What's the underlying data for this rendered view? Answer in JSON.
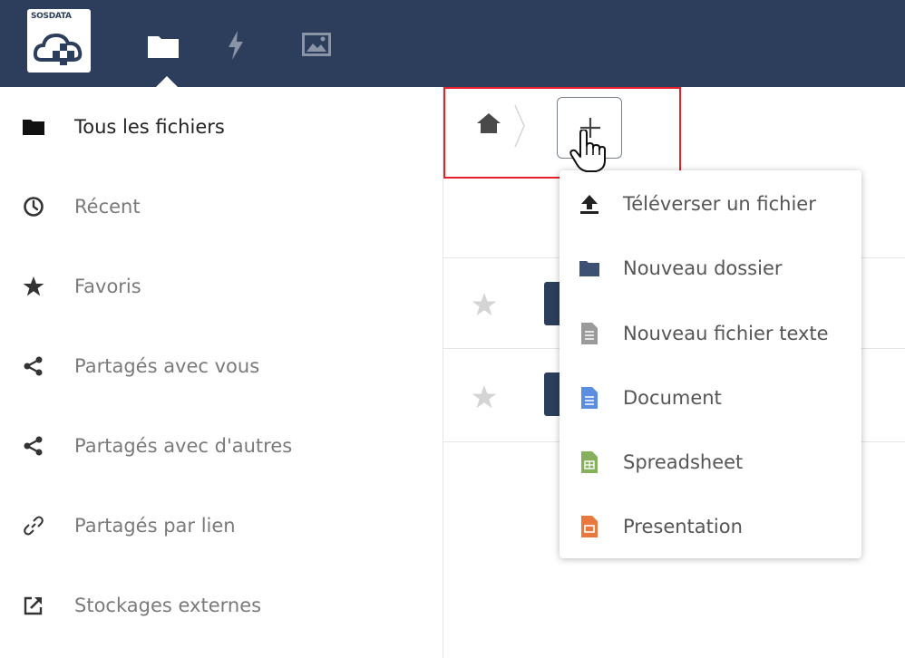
{
  "topbar": {
    "logo_text": "SOSDATA",
    "apps": [
      {
        "icon": "folder-icon",
        "active": true
      },
      {
        "icon": "activity-lightning-icon",
        "active": false
      },
      {
        "icon": "gallery-image-icon",
        "active": false
      }
    ],
    "background_color": "#2c3e5c"
  },
  "sidebar": {
    "items": [
      {
        "label": "Tous les fichiers",
        "icon": "folder-icon",
        "active": true
      },
      {
        "label": "Récent",
        "icon": "clock-icon",
        "active": false
      },
      {
        "label": "Favoris",
        "icon": "star-icon",
        "active": false
      },
      {
        "label": "Partagés avec vous",
        "icon": "share-icon",
        "active": false
      },
      {
        "label": "Partagés avec d'autres",
        "icon": "share-icon",
        "active": false
      },
      {
        "label": "Partagés par lien",
        "icon": "link-icon",
        "active": false
      },
      {
        "label": "Stockages externes",
        "icon": "external-link-icon",
        "active": false
      }
    ]
  },
  "breadcrumb": {
    "home_icon": "home-icon",
    "new_button_icon": "plus-icon"
  },
  "new_menu": {
    "items": [
      {
        "label": "Téléverser un fichier",
        "icon": "upload-icon",
        "color": "#222222"
      },
      {
        "label": "Nouveau dossier",
        "icon": "folder-icon",
        "color": "#2c3e5c"
      },
      {
        "label": "Nouveau fichier texte",
        "icon": "text-file-icon",
        "color": "#9a9a9a"
      },
      {
        "label": "Document",
        "icon": "document-icon",
        "color": "#5b8ee0"
      },
      {
        "label": "Spreadsheet",
        "icon": "spreadsheet-icon",
        "color": "#86b05c"
      },
      {
        "label": "Presentation",
        "icon": "presentation-icon",
        "color": "#e8793e"
      }
    ]
  },
  "colors": {
    "accent": "#2c3e5c",
    "highlight": "#e8202a"
  }
}
